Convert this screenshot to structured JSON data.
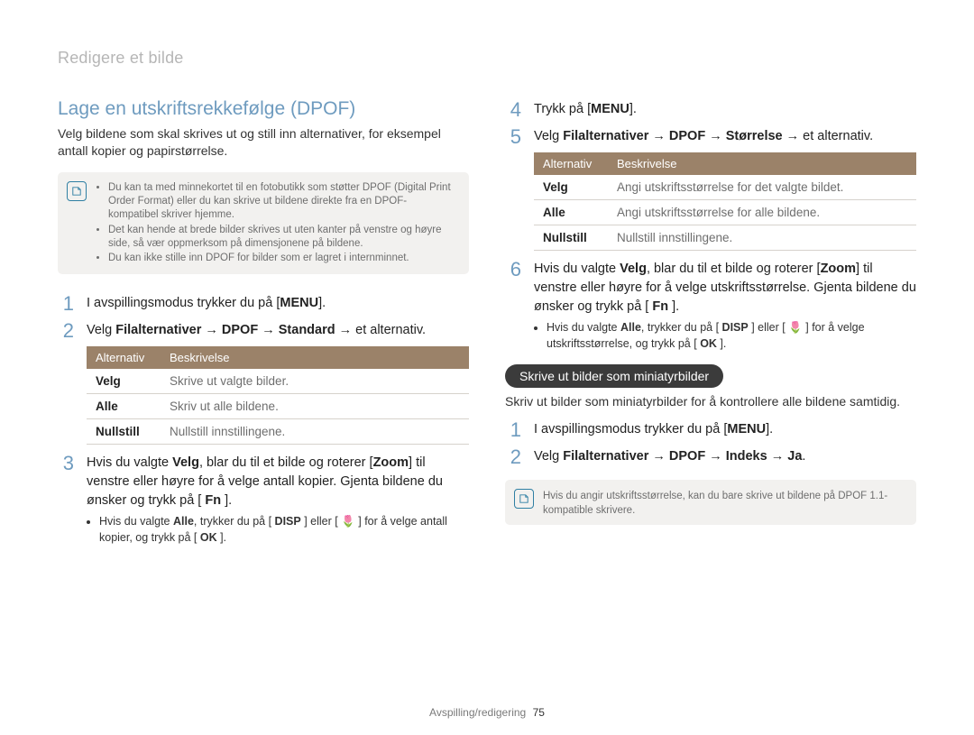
{
  "breadcrumb": "Redigere et bilde",
  "section_title": "Lage en utskriftsrekkefølge (DPOF)",
  "intro": "Velg bildene som skal skrives ut og still inn alternativer, for eksempel antall kopier og papirstørrelse.",
  "note1": {
    "items": [
      "Du kan ta med minnekortet til en fotobutikk som støtter DPOF (Digital Print Order Format) eller du kan skrive ut bildene direkte fra en DPOF-kompatibel skriver hjemme.",
      "Det kan hende at brede bilder skrives ut uten kanter på venstre og høyre side, så vær oppmerksom på dimensjonene på bildene.",
      "Du kan ikke stille inn DPOF for bilder som er lagret i internminnet."
    ]
  },
  "steps_left": {
    "s1": {
      "pre": "I avspillingsmodus trykker du på [",
      "kbd": "MENU",
      "post": "]."
    },
    "s2": {
      "pre": "Velg ",
      "b1": "Filalternativer",
      "arrow1": " → ",
      "b2": "DPOF",
      "arrow2": " → ",
      "b3": "Standard",
      "arrow3": " → et alternativ."
    },
    "s3": {
      "line": "Hvis du valgte Velg, blar du til et bilde og roterer [Zoom] til venstre eller høyre for å velge antall kopier. Gjenta bildene du ønsker og trykk på [ Fn ].",
      "sub": "Hvis du valgte Alle, trykker du på [ DISP ] eller [ 🌷 ] for å velge antall kopier, og trykk på [ OK ]."
    }
  },
  "table1": {
    "headers": [
      "Alternativ",
      "Beskrivelse"
    ],
    "rows": [
      [
        "Velg",
        "Skrive ut valgte bilder."
      ],
      [
        "Alle",
        "Skriv ut alle bildene."
      ],
      [
        "Nullstill",
        "Nullstill innstillingene."
      ]
    ]
  },
  "steps_right": {
    "s4": {
      "pre": "Trykk på [",
      "kbd": "MENU",
      "post": "]."
    },
    "s5": {
      "pre": "Velg ",
      "b1": "Filalternativer",
      "arrow1": " → ",
      "b2": "DPOF",
      "arrow2": " → ",
      "b3": "Størrelse",
      "arrow3": " → et alternativ."
    },
    "s6": {
      "line": "Hvis du valgte Velg, blar du til et bilde og roterer [Zoom] til venstre eller høyre for å velge utskriftsstørrelse. Gjenta bildene du ønsker og trykk på [ Fn ].",
      "sub": "Hvis du valgte Alle, trykker du på [ DISP ] eller [ 🌷 ] for å velge utskriftsstørrelse, og trykk på [ OK ]."
    }
  },
  "table2": {
    "headers": [
      "Alternativ",
      "Beskrivelse"
    ],
    "rows": [
      [
        "Velg",
        "Angi utskriftsstørrelse for det valgte bildet."
      ],
      [
        "Alle",
        "Angi utskriftsstørrelse for alle bildene."
      ],
      [
        "Nullstill",
        "Nullstill innstillingene."
      ]
    ]
  },
  "pill": "Skrive ut bilder som miniatyrbilder",
  "after_pill": "Skriv ut bilder som miniatyrbilder for å kontrollere alle bildene samtidig.",
  "steps_mini": {
    "s1": {
      "pre": "I avspillingsmodus trykker du på [",
      "kbd": "MENU",
      "post": "]."
    },
    "s2": {
      "pre": "Velg ",
      "b1": "Filalternativer",
      "arrow1": " → ",
      "b2": "DPOF",
      "arrow2": " → ",
      "b3": "Indeks",
      "arrow3": " → ",
      "b4": "Ja",
      "post": "."
    }
  },
  "note2": "Hvis du angir utskriftsstørrelse, kan du bare skrive ut bildene på DPOF 1.1-kompatible skrivere.",
  "footer_section": "Avspilling/redigering",
  "footer_page": "75"
}
